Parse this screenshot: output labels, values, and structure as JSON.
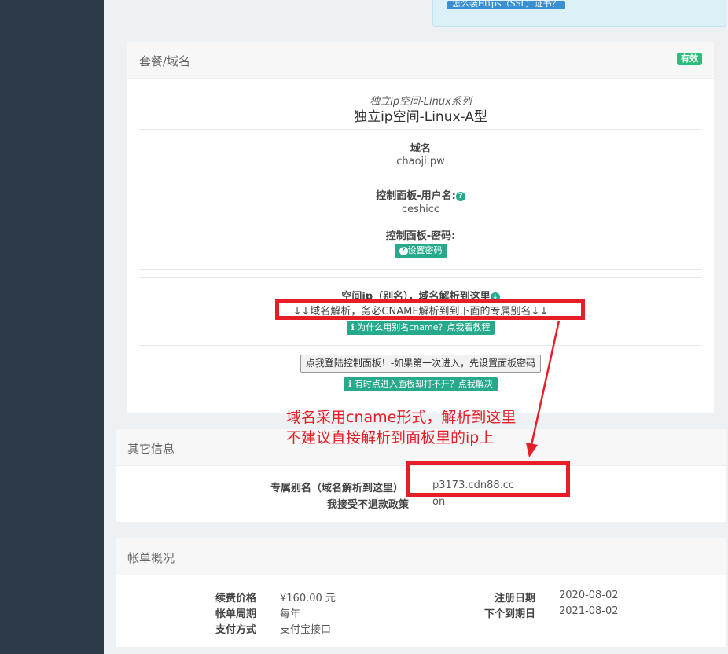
{
  "top_link": "怎么装Https（SSL）证书？",
  "package": {
    "title": "套餐/域名",
    "status": "有效",
    "series": "独立ip空间-Linux系列",
    "product": "独立ip空间-Linux-A型",
    "domain_label": "域名",
    "domain_value": "chaoji.pw",
    "panel_user_label": "控制面板-用户名:",
    "panel_user_value": "ceshicc",
    "panel_pass_label": "控制面板-密码:",
    "set_password": "设置密码",
    "space_ip_label": "空间ip（别名），域名解析到这里",
    "cname_notice": "↓↓域名解析，务必CNAME解析到到下面的专属别名↓↓",
    "cname_why": "为什么用别名cname？点我看教程",
    "login_button": "点我登陆控制面板！-如果第一次进入，先设置面板密码",
    "login_trouble": "有时点进入面板却打不开？点我解决"
  },
  "annotation": {
    "line1": "域名采用cname形式，解析到这里",
    "line2": "不建议直接解析到面板里的ip上"
  },
  "other": {
    "title": "其它信息",
    "alias_label": "专属别名（域名解析到这里）",
    "alias_value": "p3173.cdn88.cc",
    "refund_label": "我接受不退款政策",
    "refund_value": "on"
  },
  "billing": {
    "title": "帐单概况",
    "renew_label": "续费价格",
    "renew_value": "¥160.00 元",
    "cycle_label": "帐单周期",
    "cycle_value": "每年",
    "pay_label": "支付方式",
    "pay_value": "支付宝接口",
    "reg_label": "注册日期",
    "reg_value": "2020-08-02",
    "due_label": "下个到期日",
    "due_value": "2021-08-02"
  },
  "colors": {
    "accent": "#27a98c",
    "annotation": "#e61e27",
    "sidebar": "#2c3a47"
  }
}
